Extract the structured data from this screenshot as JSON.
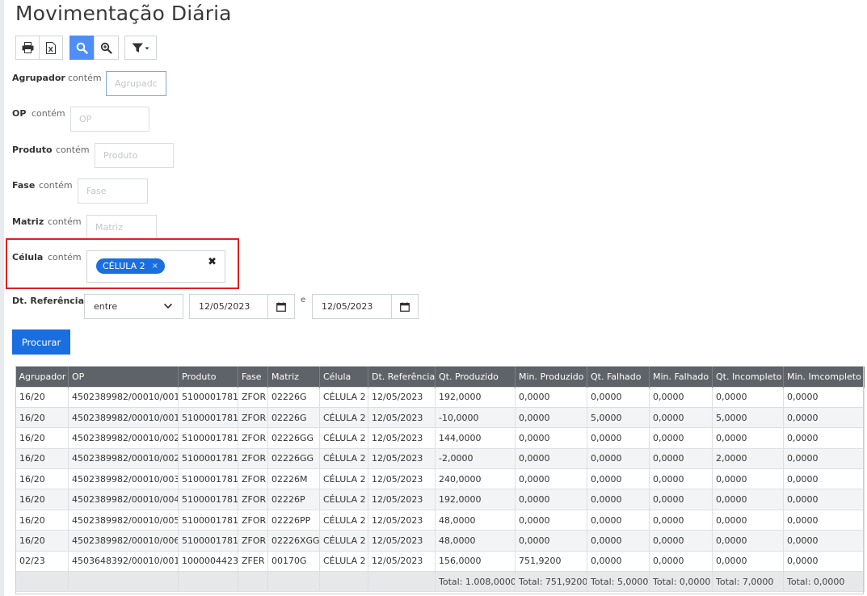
{
  "page": {
    "title": "Movimentação Diária"
  },
  "toolbar": {
    "buttons": [
      {
        "name": "print-button",
        "icon": "printer-icon"
      },
      {
        "name": "export-excel-button",
        "icon": "excel-icon"
      },
      {
        "name": "search-button",
        "icon": "search-icon",
        "active": true
      },
      {
        "name": "zoom-button",
        "icon": "zoom-in-icon"
      },
      {
        "name": "filter-dropdown-button",
        "icon": "filter-icon"
      }
    ]
  },
  "filters": {
    "agrupador": {
      "label": "Agrupador",
      "op": "contém",
      "placeholder": "Agrupadc"
    },
    "op": {
      "label": "OP",
      "op": "contém",
      "placeholder": "OP"
    },
    "produto": {
      "label": "Produto",
      "op": "contém",
      "placeholder": "Produto"
    },
    "fase": {
      "label": "Fase",
      "op": "contém",
      "placeholder": "Fase"
    },
    "matriz": {
      "label": "Matriz",
      "op": "contém",
      "placeholder": "Matriz"
    },
    "celula": {
      "label": "Célula",
      "op": "contém",
      "tag": "CÉLULA 2",
      "tag_remove": "×",
      "clear": "✖"
    },
    "dt_ref": {
      "label": "Dt. Referência",
      "mode": "entre",
      "from": "12/05/2023",
      "sep": "e",
      "to": "12/05/2023"
    }
  },
  "search_button": {
    "label": "Procurar"
  },
  "table": {
    "columns": [
      "Agrupador",
      "OP",
      "Produto",
      "Fase",
      "Matriz",
      "Célula",
      "Dt. Referência",
      "Qt. Produzido",
      "Min. Produzido",
      "Qt. Falhado",
      "Min. Falhado",
      "Qt. Incompleto",
      "Min. Imcompleto"
    ],
    "rows": [
      [
        "16/20",
        "4502389982/00010/001",
        "5100001781",
        "ZFOR",
        "02226G",
        "CÉLULA 2",
        "12/05/2023",
        "192,0000",
        "0,0000",
        "0,0000",
        "0,0000",
        "0,0000",
        "0,0000"
      ],
      [
        "16/20",
        "4502389982/00010/001",
        "5100001781",
        "ZFOR",
        "02226G",
        "CÉLULA 2",
        "12/05/2023",
        "-10,0000",
        "0,0000",
        "5,0000",
        "0,0000",
        "5,0000",
        "0,0000"
      ],
      [
        "16/20",
        "4502389982/00010/002",
        "5100001781",
        "ZFOR",
        "02226GG",
        "CÉLULA 2",
        "12/05/2023",
        "144,0000",
        "0,0000",
        "0,0000",
        "0,0000",
        "0,0000",
        "0,0000"
      ],
      [
        "16/20",
        "4502389982/00010/002",
        "5100001781",
        "ZFOR",
        "02226GG",
        "CÉLULA 2",
        "12/05/2023",
        "-2,0000",
        "0,0000",
        "0,0000",
        "0,0000",
        "2,0000",
        "0,0000"
      ],
      [
        "16/20",
        "4502389982/00010/003",
        "5100001781",
        "ZFOR",
        "02226M",
        "CÉLULA 2",
        "12/05/2023",
        "240,0000",
        "0,0000",
        "0,0000",
        "0,0000",
        "0,0000",
        "0,0000"
      ],
      [
        "16/20",
        "4502389982/00010/004",
        "5100001781",
        "ZFOR",
        "02226P",
        "CÉLULA 2",
        "12/05/2023",
        "192,0000",
        "0,0000",
        "0,0000",
        "0,0000",
        "0,0000",
        "0,0000"
      ],
      [
        "16/20",
        "4502389982/00010/005",
        "5100001781",
        "ZFOR",
        "02226PP",
        "CÉLULA 2",
        "12/05/2023",
        "48,0000",
        "0,0000",
        "0,0000",
        "0,0000",
        "0,0000",
        "0,0000"
      ],
      [
        "16/20",
        "4502389982/00010/006",
        "5100001781",
        "ZFOR",
        "02226XGG",
        "CÉLULA 2",
        "12/05/2023",
        "48,0000",
        "0,0000",
        "0,0000",
        "0,0000",
        "0,0000",
        "0,0000"
      ],
      [
        "02/23",
        "4503648392/00010/001",
        "1000004423",
        "ZFER",
        "00170G",
        "CÉLULA 2",
        "12/05/2023",
        "156,0000",
        "751,9200",
        "0,0000",
        "0,0000",
        "0,0000",
        "0,0000"
      ]
    ],
    "totals": [
      "",
      "",
      "",
      "",
      "",
      "",
      "",
      "Total: 1.008,0000",
      "Total: 751,9200",
      "Total: 5,0000",
      "Total: 0,0000",
      "Total: 7,0000",
      "Total: 0,0000"
    ]
  }
}
